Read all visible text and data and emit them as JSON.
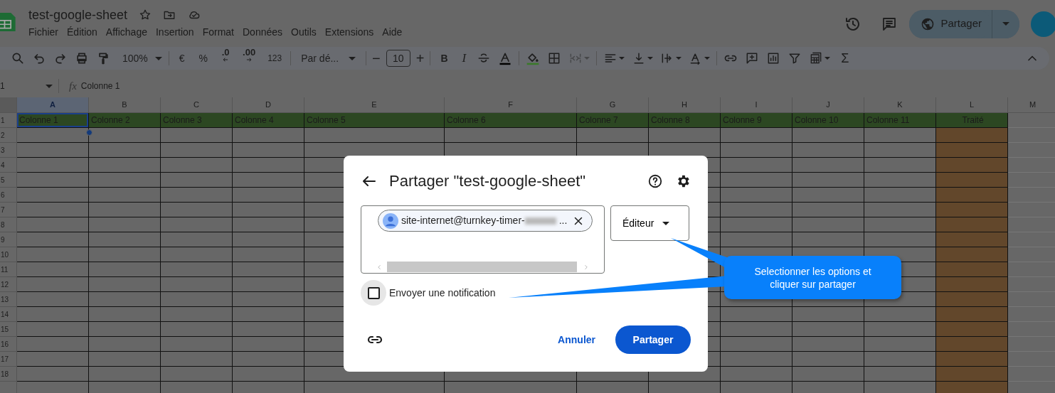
{
  "document": {
    "title": "test-google-sheet",
    "menu": [
      "Fichier",
      "Édition",
      "Affichage",
      "Insertion",
      "Format",
      "Données",
      "Outils",
      "Extensions",
      "Aide"
    ]
  },
  "header_actions": {
    "share_label": "Partager"
  },
  "toolbar": {
    "zoom": "100%",
    "currency": "€",
    "percent": "%",
    "decrease_decimals": ".0",
    "increase_decimals": ".00",
    "number_format": "123",
    "font": "Par dé...",
    "font_size_minus": "−",
    "font_size": "10",
    "font_size_plus": "+",
    "bold": "B",
    "italic": "I",
    "sum": "Σ",
    "merge_disabled": true
  },
  "formula_bar": {
    "cell_ref": "1",
    "fx": "fx",
    "formula": "Colonne 1"
  },
  "grid": {
    "columns": [
      {
        "label": "A",
        "selected": true
      },
      {
        "label": "B",
        "selected": false
      },
      {
        "label": "C",
        "selected": false
      },
      {
        "label": "D",
        "selected": false
      },
      {
        "label": "E",
        "selected": false
      },
      {
        "label": "F",
        "selected": false
      },
      {
        "label": "G",
        "selected": false
      },
      {
        "label": "H",
        "selected": false
      },
      {
        "label": "I",
        "selected": false
      },
      {
        "label": "J",
        "selected": false
      },
      {
        "label": "K",
        "selected": false
      },
      {
        "label": "L",
        "selected": false,
        "color": "#62472b"
      },
      {
        "label": "M",
        "selected": false
      }
    ],
    "rows": [
      {
        "number": "1",
        "color": "#2c4722",
        "cells": [
          {
            "text": "Colonne 1",
            "selected": true
          },
          {
            "text": "Colonne 2",
            "selected": false
          },
          {
            "text": "Colonne 3",
            "selected": false
          },
          {
            "text": "Colonne 4",
            "selected": false
          },
          {
            "text": "Colonne 5",
            "selected": false
          },
          {
            "text": "Colonne 6",
            "selected": false
          },
          {
            "text": "Colonne 7",
            "selected": false
          },
          {
            "text": "Colonne 8",
            "selected": false
          },
          {
            "text": "Colonne 9",
            "selected": false
          },
          {
            "text": "Colonne 10",
            "selected": false
          },
          {
            "text": "Colonne 11",
            "selected": false
          },
          {
            "text": "Traité",
            "selected": false
          }
        ]
      },
      {
        "number": "2"
      },
      {
        "number": "3"
      },
      {
        "number": "4"
      },
      {
        "number": "5"
      },
      {
        "number": "6"
      },
      {
        "number": "7"
      },
      {
        "number": "8"
      },
      {
        "number": "9"
      },
      {
        "number": "10"
      },
      {
        "number": "11"
      },
      {
        "number": "12"
      },
      {
        "number": "13"
      },
      {
        "number": "14"
      },
      {
        "number": "15"
      },
      {
        "number": "16"
      },
      {
        "number": "17"
      },
      {
        "number": "18"
      }
    ]
  },
  "share_dialog": {
    "title": "Partager \"test-google-sheet\"",
    "recipients": [
      {
        "email": "site-internet@turnkey-timer-",
        "suffix": "..."
      }
    ],
    "role": "Éditeur",
    "notify": {
      "label": "Envoyer une notification",
      "checked": false
    },
    "cancel": "Annuler",
    "submit": "Partager"
  },
  "callout": {
    "text": "Selectionner les options et cliquer sur partager"
  }
}
